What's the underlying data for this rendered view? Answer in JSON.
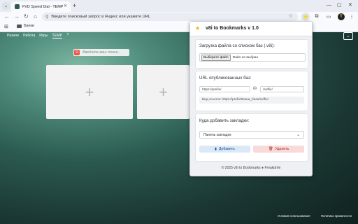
{
  "browser": {
    "tab": {
      "title": "FVD Speed Dial - TEMP"
    },
    "omnibox": {
      "placeholder": "Введите поисковый запрос в Яндекс или укажите URL"
    },
    "bookmarks_bar": {
      "folder": "Банки"
    }
  },
  "page": {
    "groups": [
      "Разное",
      "Работа",
      "Игры",
      "TEMP"
    ],
    "active_group": "TEMP",
    "search_placeholder": "Введите ваш поиск...",
    "tiles": [
      "+",
      "+"
    ],
    "footer": {
      "terms": "Условия использования",
      "privacy": "Политика приватности"
    }
  },
  "popup": {
    "title": "v8i to Bookmarks v 1.0",
    "upload": {
      "heading": "Загрузка файла со списком баз (.v8i):",
      "button": "Выберите файл",
      "status": "Файл не выбран"
    },
    "url": {
      "heading": "URL опубликованных баз:",
      "prefix": "https://prefix/",
      "suffix": "/suffix/",
      "example": "Вид ссылок: https://prefix/Ваша_база/suffix/"
    },
    "target": {
      "heading": "Куда добавить закладки:",
      "selected": "Панель закладок"
    },
    "buttons": {
      "add": "Добавить",
      "delete": "Удалить"
    },
    "footer": {
      "copyright": "© 2025 v8i to Bookmarks",
      "author": "Freakdrrle"
    }
  },
  "icons": {
    "logo": "star-icon",
    "add": "bookmark-icon",
    "delete": "trash-icon",
    "db": "database-icon"
  },
  "colors": {
    "accent_blue": "#1a4c8a",
    "danger_red": "#b02525",
    "star": "#f0b400"
  }
}
